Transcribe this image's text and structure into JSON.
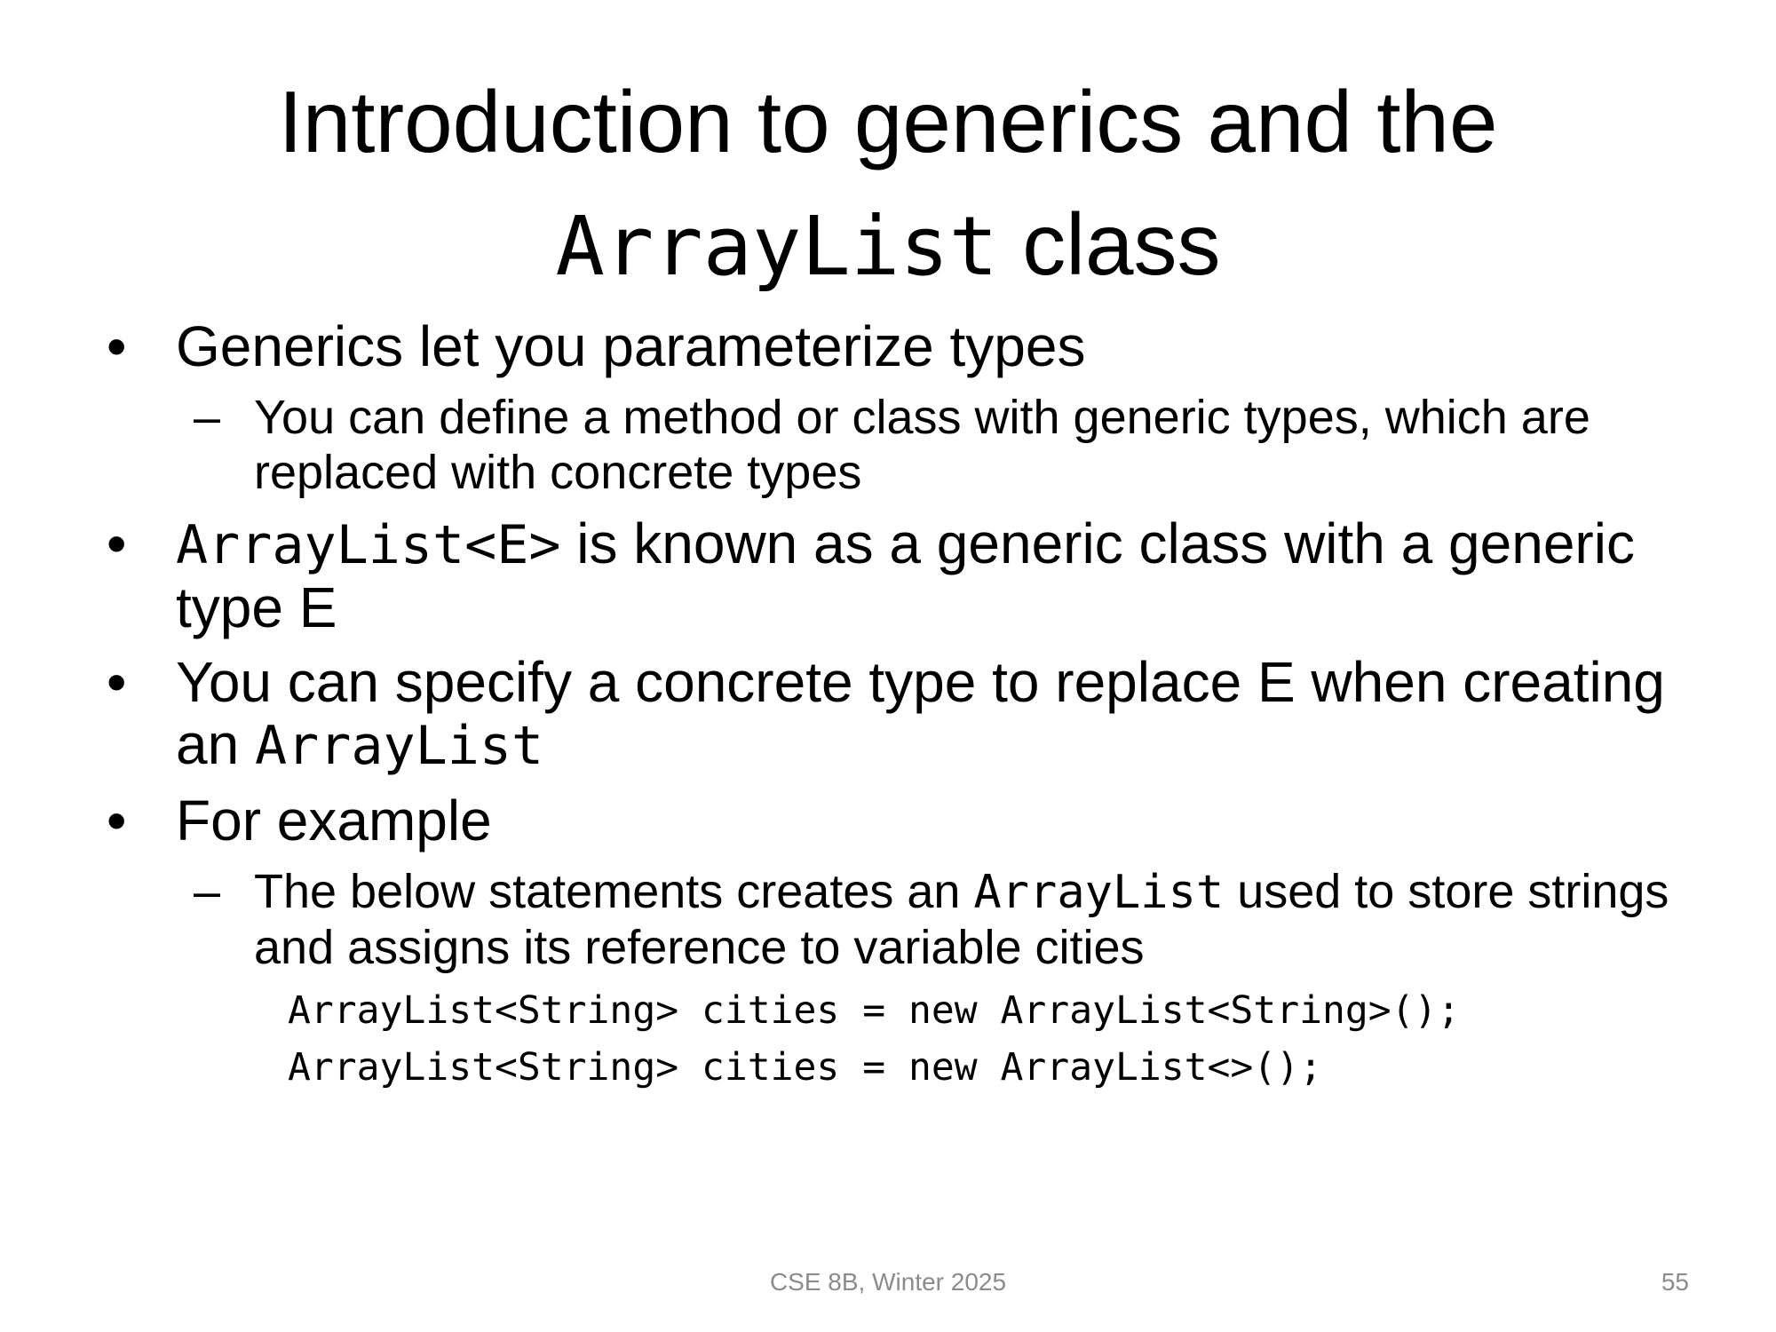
{
  "slide": {
    "title": {
      "line1": "Introduction to generics and the",
      "code": "ArrayList",
      "suffix": " class"
    },
    "bullets": [
      {
        "text": "Generics let you parameterize types",
        "sub": "You can define a method or class with generic types, which are replaced with concrete types"
      },
      {
        "code": "ArrayList<E>",
        "text": " is known as a generic class with a generic type E"
      },
      {
        "text": "You can specify a concrete type to replace E when creating an ",
        "code": "ArrayList"
      },
      {
        "text": "For example",
        "sub_prefix": "The below statements creates an ",
        "sub_code": "ArrayList",
        "sub_suffix": " used to store strings and assigns its reference to variable cities",
        "code_lines": [
          "ArrayList<String> cities = new ArrayList<String>();",
          "ArrayList<String> cities = new ArrayList<>();"
        ]
      }
    ],
    "bullet_char": "•",
    "dash_char": "–"
  },
  "footer": {
    "course": "CSE 8B, Winter 2025",
    "page_number": "55"
  }
}
